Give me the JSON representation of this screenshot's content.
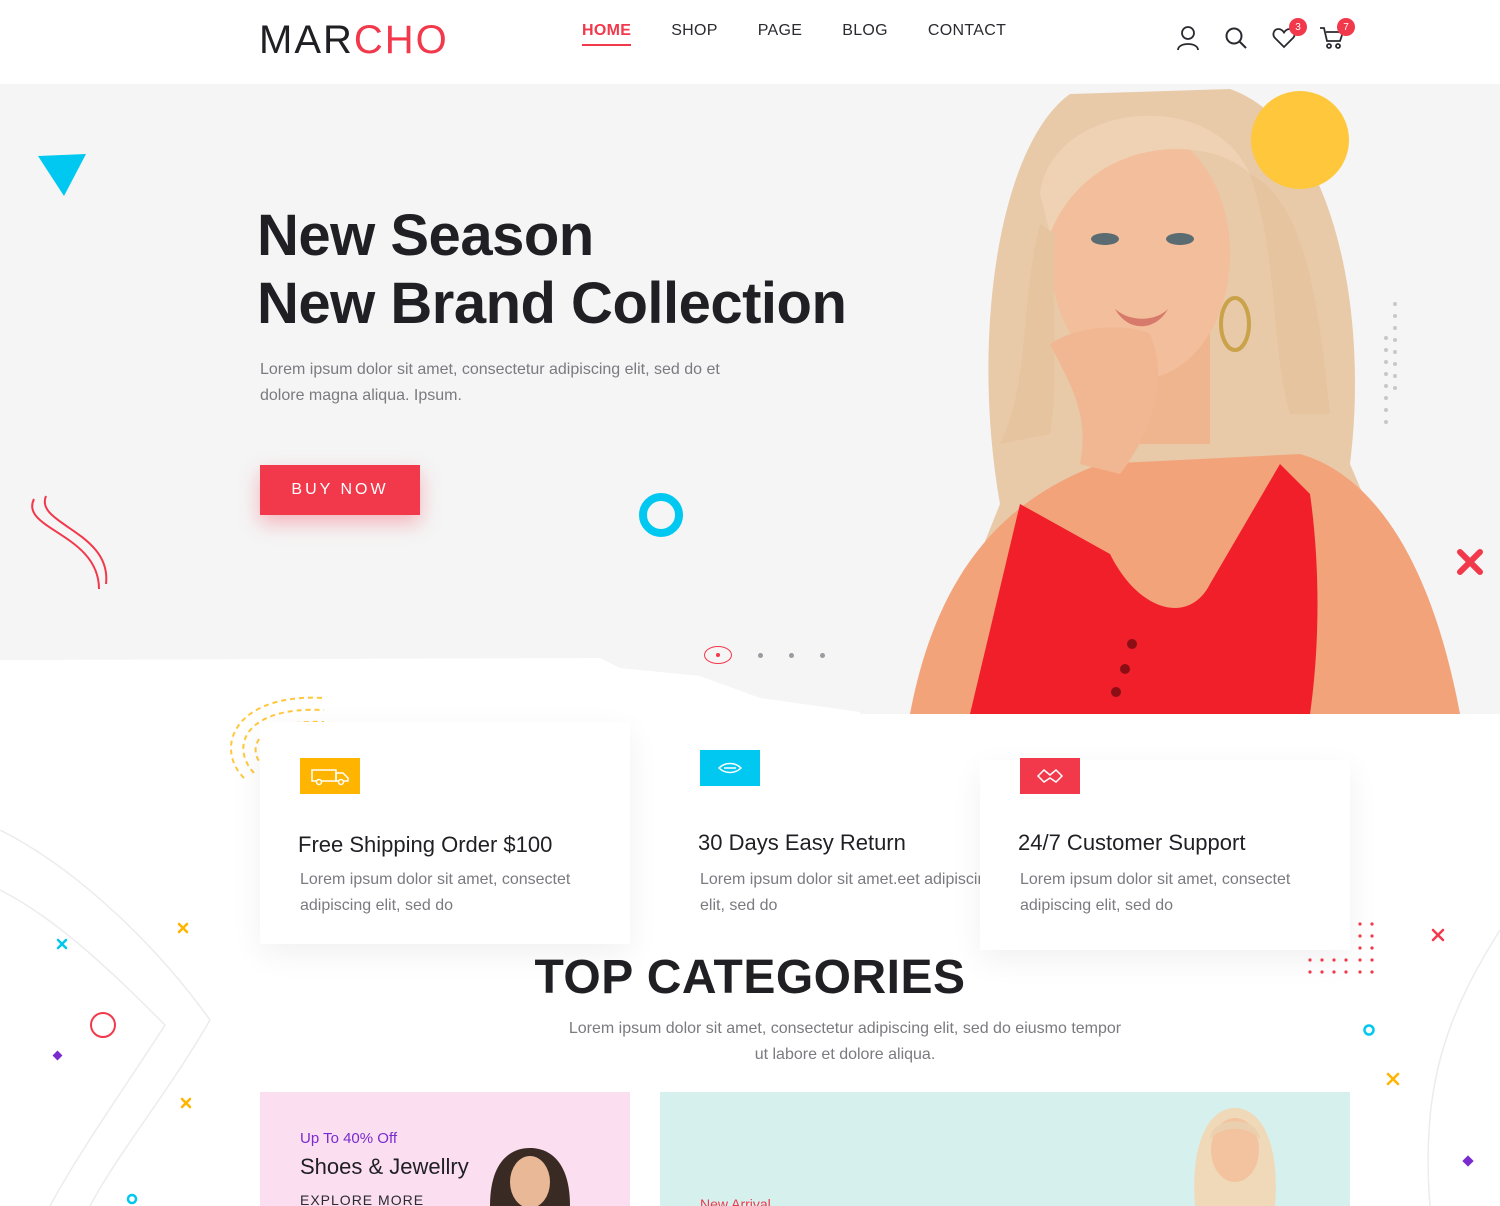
{
  "header": {
    "logo_part1": "MAR",
    "logo_part2": "CHO",
    "nav": [
      "HOME",
      "SHOP",
      "PAGE",
      "BLOG",
      "CONTACT"
    ],
    "active_nav": "HOME",
    "wishlist_count": "3",
    "cart_count": "7",
    "icons": [
      "user-icon",
      "search-icon",
      "heart-icon",
      "cart-icon"
    ]
  },
  "hero": {
    "title_line1": "New Season",
    "title_line2": "New Brand Collection",
    "description": "Lorem ipsum dolor sit amet, consectetur adipiscing elit, sed do et dolore magna aliqua. Ipsum.",
    "button_label": "BUY NOW",
    "slides": 4,
    "active_slide": 1
  },
  "features": [
    {
      "title": "Free Shipping Order $100",
      "description": "Lorem ipsum dolor sit amet, consectet adipiscing elit, sed do",
      "icon": "truck-icon",
      "color": "#ffb400"
    },
    {
      "title": "30 Days Easy Return",
      "description": "Lorem ipsum dolor sit amet.eet adipiscing elit, sed do",
      "icon": "return-icon",
      "color": "#00c8f0"
    },
    {
      "title": "24/7 Customer Support",
      "description": "Lorem ipsum dolor sit amet, consectet adipiscing elit, sed do",
      "icon": "support-icon",
      "color": "#f2394c"
    }
  ],
  "categories": {
    "title": "TOP CATEGORIES",
    "description": "Lorem ipsum dolor sit amet, consectetur adipiscing elit, sed do eiusmo tempor ut labore et dolore aliqua.",
    "card1": {
      "offer": "Up To 40% Off",
      "name": "Shoes & Jewellry",
      "link": "EXPLORE MORE"
    },
    "card2": {
      "label": "New Arrival"
    }
  },
  "colors": {
    "accent": "#f2394c",
    "cyan": "#00c8f0",
    "yellow": "#ffc83c",
    "purple": "#7a2bd0"
  }
}
